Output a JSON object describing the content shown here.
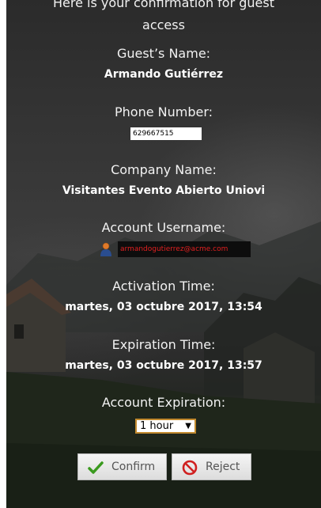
{
  "header": {
    "line1": "Here is your confirmation for guest",
    "line2": "access"
  },
  "guest": {
    "name_label": "Guest’s Name:",
    "name_value": "Armando Gutiérrez"
  },
  "phone": {
    "label": "Phone Number:",
    "value": "629667515"
  },
  "company": {
    "label": "Company Name:",
    "value": "Visitantes Evento Abierto Uniovi"
  },
  "account": {
    "label": "Account Username:",
    "value": "armandogutierrez@acme.com",
    "avatar_icon": "user-avatar-icon"
  },
  "activation": {
    "label": "Activation Time:",
    "value": "martes, 03 octubre 2017, 13:54"
  },
  "expiration_time": {
    "label": "Expiration Time:",
    "value": "martes, 03 octubre 2017, 13:57"
  },
  "account_expiration": {
    "label": "Account Expiration:",
    "selected": "1 hour"
  },
  "actions": {
    "confirm_label": "Confirm",
    "confirm_icon": "checkmark-icon",
    "confirm_color": "#3a9a1e",
    "reject_label": "Reject",
    "reject_icon": "no-entry-icon",
    "reject_color": "#d02020"
  }
}
